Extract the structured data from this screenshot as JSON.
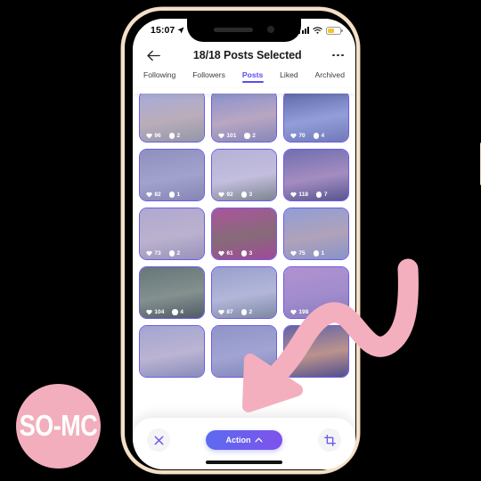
{
  "status_bar": {
    "time": "15:07",
    "location_icon": "location-arrow-icon",
    "signal_icon": "cellular-signal-icon",
    "wifi_icon": "wifi-icon",
    "battery_icon": "battery-low-power-icon"
  },
  "header": {
    "back_icon": "back-arrow-icon",
    "title": "18/18 Posts Selected",
    "more_icon": "more-options-icon"
  },
  "tabs": [
    {
      "label": "Following",
      "active": false
    },
    {
      "label": "Followers",
      "active": false
    },
    {
      "label": "Posts",
      "active": true
    },
    {
      "label": "Liked",
      "active": false
    },
    {
      "label": "Archived",
      "active": false
    }
  ],
  "grid": {
    "tiles": [
      {
        "likes": "96",
        "comments": "2",
        "alt": "dune-beach-sunset",
        "c1": "#b9c8d8",
        "c2": "#d8c9a8",
        "c3": "#9fa98f"
      },
      {
        "likes": "101",
        "comments": "2",
        "alt": "beach-path-clouds",
        "c1": "#8e9fc4",
        "c2": "#d6bfb4",
        "c3": "#8c94a6"
      },
      {
        "likes": "70",
        "comments": "4",
        "alt": "clouds-rainbow-sky",
        "c1": "#53648f",
        "c2": "#9fb3d4",
        "c3": "#6e7fa6"
      },
      {
        "likes": "82",
        "comments": "1",
        "alt": "kite-surfer-grey-sea",
        "c1": "#9a9fae",
        "c2": "#b5b9c4",
        "c3": "#8c91a0"
      },
      {
        "likes": "92",
        "comments": "3",
        "alt": "goslings-in-grass",
        "c1": "#cfcfd2",
        "c2": "#e4e1dc",
        "c3": "#7e9069"
      },
      {
        "likes": "118",
        "comments": "7",
        "alt": "lighthouse-dusk",
        "c1": "#6e6f9b",
        "c2": "#b89bb0",
        "c3": "#4a4a6e"
      },
      {
        "likes": "73",
        "comments": "2",
        "alt": "calm-sea-groynes",
        "c1": "#c9c2c6",
        "c2": "#d9cfc6",
        "c3": "#a8a3a8"
      },
      {
        "likes": "61",
        "comments": "3",
        "alt": "butterfly-on-blossom",
        "c1": "#c24a7c",
        "c2": "#8c6a4a",
        "c3": "#b8397a"
      },
      {
        "likes": "75",
        "comments": "1",
        "alt": "harbour-town-houses",
        "c1": "#9eb3cc",
        "c2": "#c9b9a8",
        "c3": "#8fa4bd"
      },
      {
        "likes": "104",
        "comments": "4",
        "alt": "bird-on-fence-post",
        "c1": "#5f7a4a",
        "c2": "#89a06a",
        "c3": "#3f5230"
      },
      {
        "likes": "87",
        "comments": "2",
        "alt": "aerial-coastline",
        "c1": "#a7b6c2",
        "c2": "#cdd6d4",
        "c3": "#7f9488"
      },
      {
        "likes": "198",
        "comments": "",
        "alt": "pier-pink-sunset",
        "c1": "#c9a2c4",
        "c2": "#b49ac4",
        "c3": "#8e7fa8"
      },
      {
        "likes": "",
        "comments": "",
        "alt": "photo-collage",
        "c1": "#b6bdc9",
        "c2": "#d9d3cc",
        "c3": "#8f9aa8"
      },
      {
        "likes": "",
        "comments": "",
        "alt": "overcast-sea",
        "c1": "#9aa5bb",
        "c2": "#b4bccb",
        "c3": "#848fa6"
      },
      {
        "likes": "",
        "comments": "",
        "alt": "golden-sunset-fence",
        "c1": "#5b5f8c",
        "c2": "#d9a367",
        "c3": "#3e4268"
      }
    ]
  },
  "bottom_bar": {
    "close_icon": "close-x-icon",
    "action_label": "Action",
    "action_chevron_icon": "chevron-up-icon",
    "crop_icon": "crop-icon"
  },
  "annotation": {
    "arrow_icon": "pink-curved-arrow-icon",
    "arrow_color": "#f4afbe"
  },
  "logo": {
    "text": "SO-MC",
    "background_color": "#f2aebc"
  },
  "theme": {
    "accent": "#5b4bf5",
    "tile_border": "#6c5ce7",
    "page_background": "#000000",
    "phone_frame": "#f5dfc8"
  }
}
